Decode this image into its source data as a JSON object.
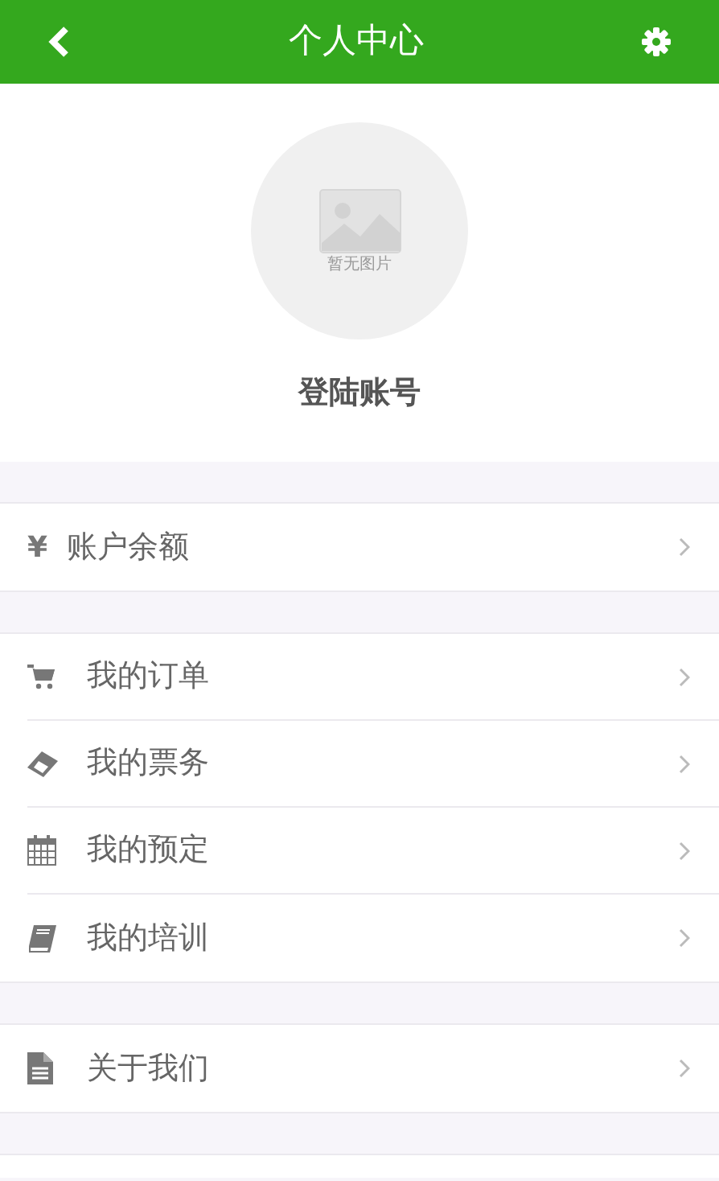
{
  "header": {
    "title": "个人中心"
  },
  "profile": {
    "placeholder_caption": "暂无图片",
    "account": "登陆账号"
  },
  "groups": [
    [
      {
        "kind": "yen",
        "symbol": "¥",
        "label": "账户余额"
      }
    ],
    [
      {
        "kind": "cart",
        "label": "我的订单"
      },
      {
        "kind": "ticket",
        "label": "我的票务"
      },
      {
        "kind": "calendar",
        "label": "我的预定"
      },
      {
        "kind": "book",
        "label": "我的培训"
      }
    ],
    [
      {
        "kind": "document",
        "label": "关于我们"
      }
    ]
  ]
}
